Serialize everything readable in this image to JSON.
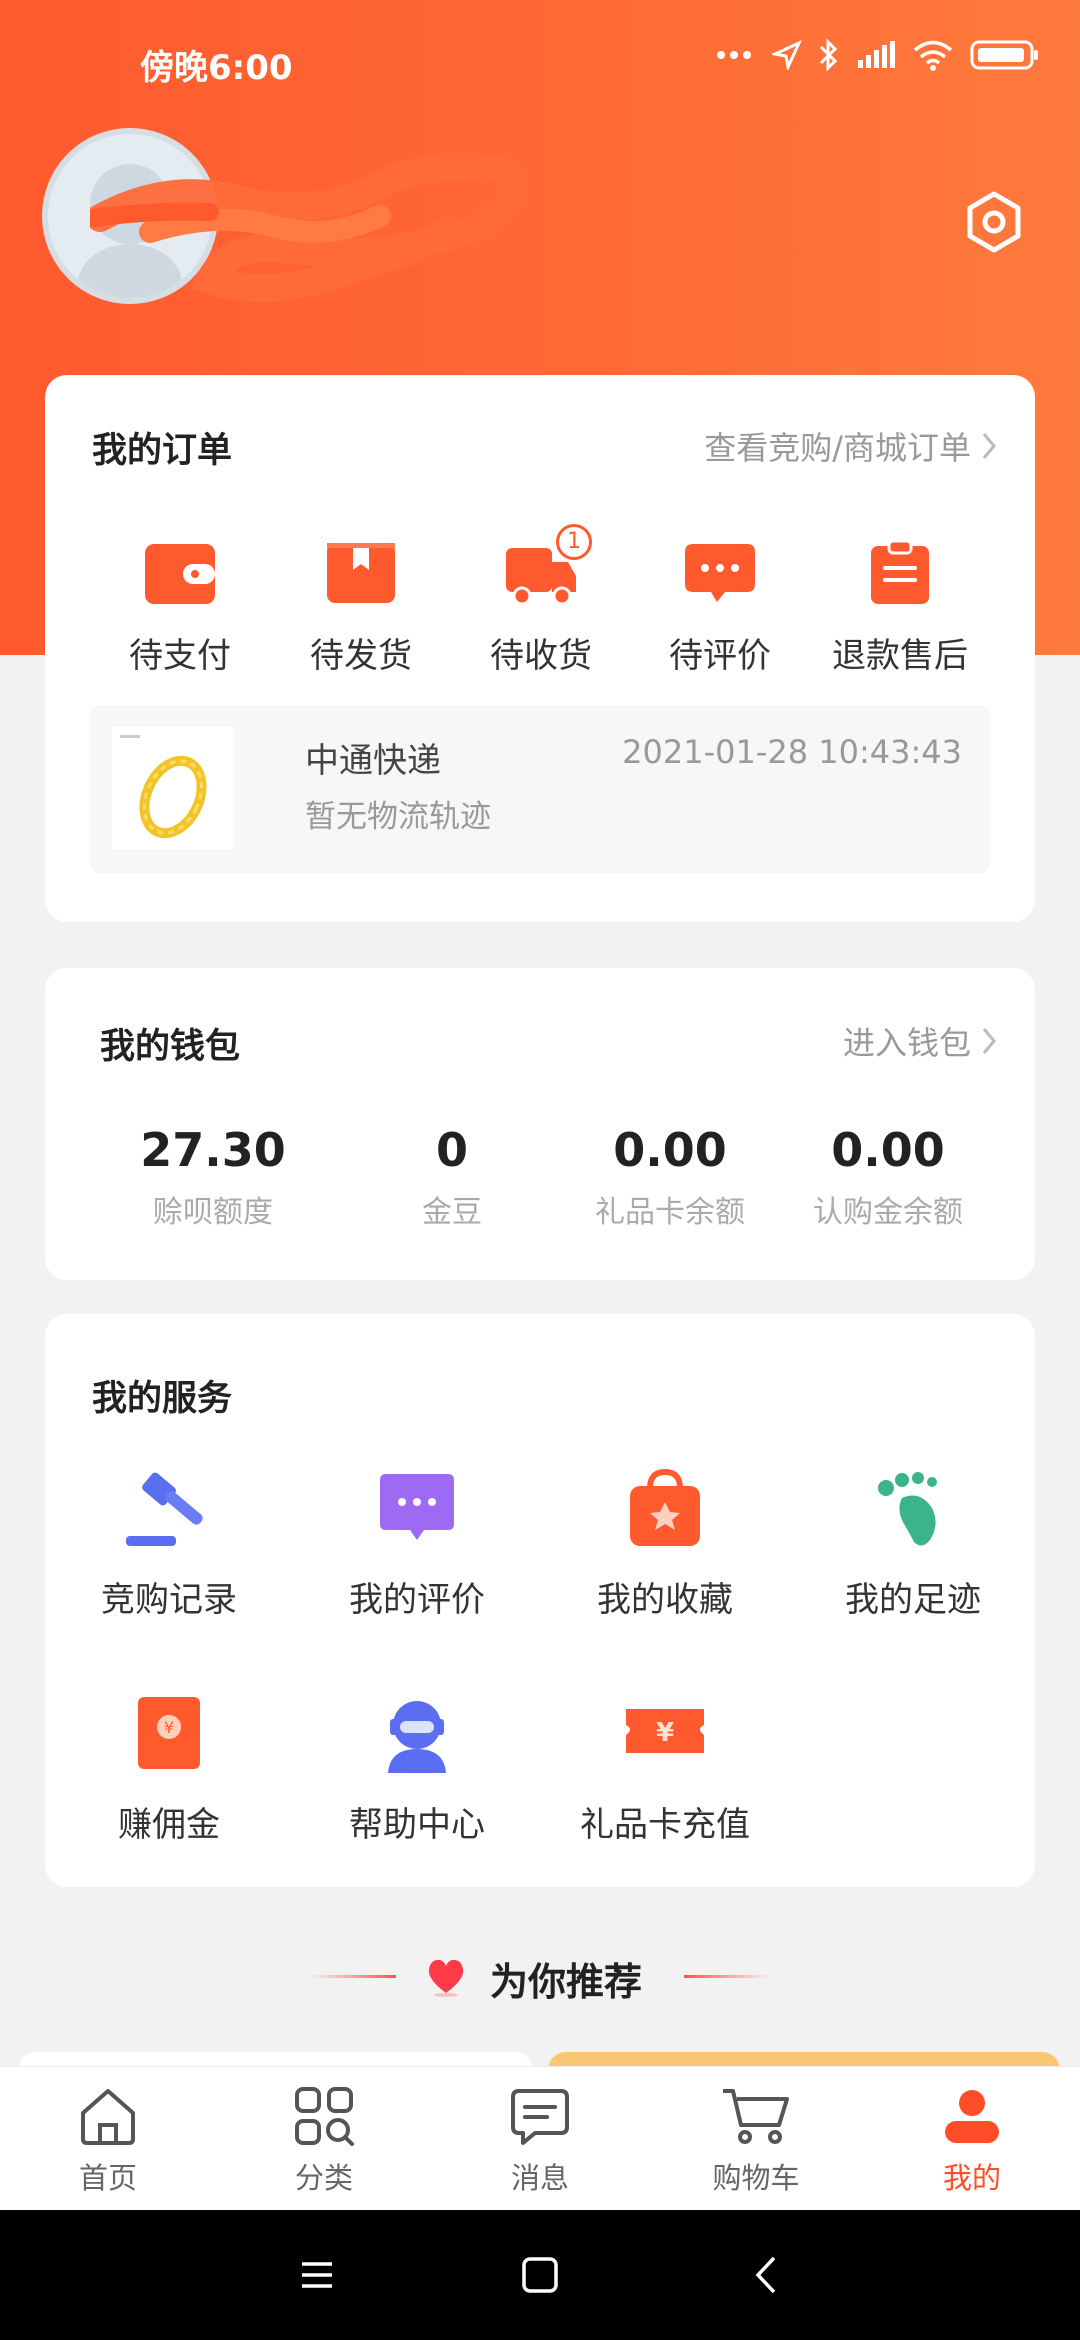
{
  "status_bar": {
    "time": "傍晚6:00"
  },
  "orders": {
    "title": "我的订单",
    "link": "查看竞购/商城订单",
    "items": [
      {
        "label": "待支付",
        "icon": "wallet-icon"
      },
      {
        "label": "待发货",
        "icon": "box-icon"
      },
      {
        "label": "待收货",
        "icon": "truck-icon",
        "badge": "1"
      },
      {
        "label": "待评价",
        "icon": "chat-icon"
      },
      {
        "label": "退款售后",
        "icon": "clipboard-icon"
      }
    ],
    "tracking": {
      "carrier": "中通快递",
      "status": "暂无物流轨迹",
      "time": "2021-01-28 10:43:43"
    }
  },
  "wallet": {
    "title": "我的钱包",
    "link": "进入钱包",
    "items": [
      {
        "value": "27.30",
        "label": "赊呗额度"
      },
      {
        "value": "0",
        "label": "金豆"
      },
      {
        "value": "0.00",
        "label": "礼品卡余额"
      },
      {
        "value": "0.00",
        "label": "认购金余额"
      }
    ]
  },
  "services": {
    "title": "我的服务",
    "items": [
      {
        "label": "竞购记录",
        "icon": "gavel-icon"
      },
      {
        "label": "我的评价",
        "icon": "comment-icon"
      },
      {
        "label": "我的收藏",
        "icon": "favorite-bag-icon"
      },
      {
        "label": "我的足迹",
        "icon": "footprint-icon"
      },
      {
        "label": "赚佣金",
        "icon": "red-envelope-icon"
      },
      {
        "label": "帮助中心",
        "icon": "support-agent-icon"
      },
      {
        "label": "礼品卡充值",
        "icon": "gift-card-icon"
      }
    ]
  },
  "recommend": {
    "title": "为你推荐"
  },
  "tabbar": {
    "items": [
      {
        "label": "首页",
        "icon": "home-icon"
      },
      {
        "label": "分类",
        "icon": "category-icon"
      },
      {
        "label": "消息",
        "icon": "message-icon"
      },
      {
        "label": "购物车",
        "icon": "cart-icon"
      },
      {
        "label": "我的",
        "icon": "profile-icon",
        "active": true
      }
    ]
  },
  "colors": {
    "brand": "#ff5a2e",
    "active_tab": "#ff4d2a"
  }
}
